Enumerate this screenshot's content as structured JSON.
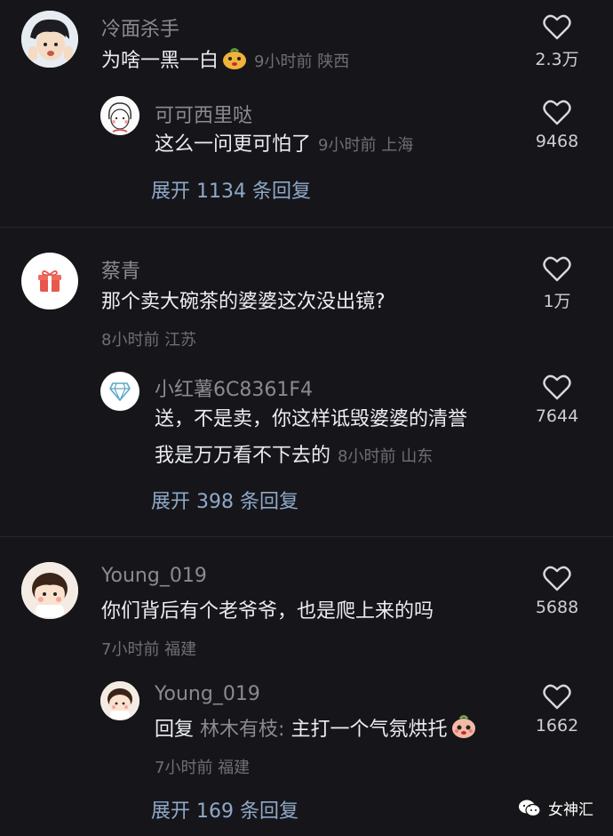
{
  "threads": [
    {
      "comment": {
        "user": "冷面杀手",
        "text": "为啥一黑一白",
        "meta": "9小时前 陕西",
        "likes": "2.3万"
      },
      "reply": {
        "user": "可可西里哒",
        "text": "这么一问更可怕了",
        "meta": "9小时前 上海",
        "likes": "9468"
      },
      "expand": "展开 1134 条回复"
    },
    {
      "comment": {
        "user": "蔡青",
        "text": "那个卖大碗茶的婆婆这次没出镜?",
        "meta": "8小时前 江苏",
        "likes": "1万"
      },
      "reply": {
        "user": "小红薯6C8361F4",
        "text_line1": "送，不是卖，你这样诋毁婆婆的清誉",
        "text_line2": "我是万万看不下去的",
        "meta": "8小时前 山东",
        "likes": "7644"
      },
      "expand": "展开 398 条回复"
    },
    {
      "comment": {
        "user": "Young_019",
        "text": "你们背后有个老爷爷，也是爬上来的吗",
        "meta": "7小时前 福建",
        "likes": "5688"
      },
      "reply": {
        "user": "Young_019",
        "reply_prefix": "回复",
        "reply_to": "林木有枝:",
        "text": "主打一个气氛烘托",
        "meta": "7小时前 福建",
        "likes": "1662"
      },
      "expand": "展开 169 条回复"
    }
  ],
  "watermark": "女神汇",
  "icons": {
    "like": "heart-outline-icon",
    "gift": "gift-icon",
    "diamond": "diamond-icon",
    "wechat": "wechat-icon"
  }
}
